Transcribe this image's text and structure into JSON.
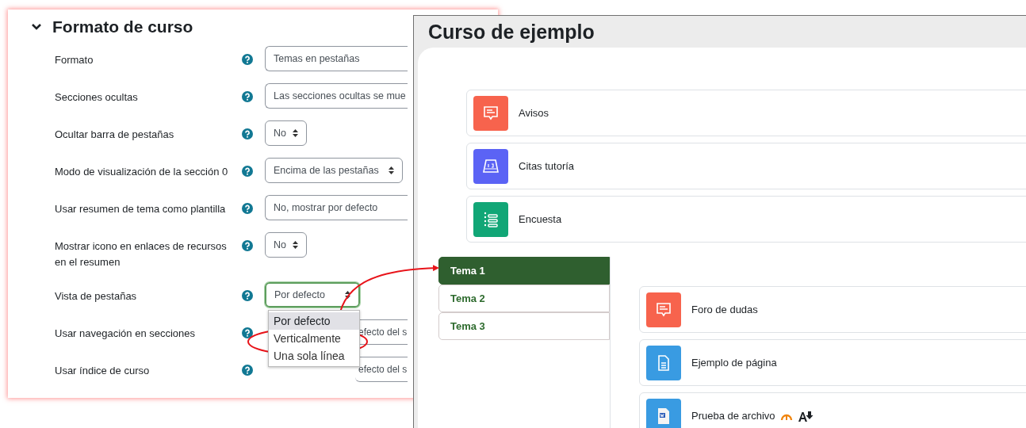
{
  "settings": {
    "title": "Formato de curso",
    "expanded": true,
    "rows": [
      {
        "label": "Formato",
        "kind": "select",
        "value": "Temas en pestañas",
        "open": false
      },
      {
        "label": "Secciones ocultas",
        "kind": "select",
        "value": "Las secciones ocultas se mue",
        "open": false
      },
      {
        "label": "Ocultar barra de pestañas",
        "kind": "select",
        "value": "No",
        "open": false
      },
      {
        "label": "Modo de visualización de la sección 0",
        "kind": "select",
        "value": "Encima de las pestañas",
        "open": false
      },
      {
        "label": "Usar resumen de tema como plantilla",
        "kind": "select",
        "value": "No, mostrar por defecto",
        "open": false
      },
      {
        "label": "Mostrar icono en enlaces de recursos en el resumen",
        "kind": "select",
        "value": "No",
        "open": false
      },
      {
        "label": "Vista de pestañas",
        "kind": "select",
        "value": "Por defecto",
        "open": true,
        "options": [
          {
            "label": "Por defecto",
            "selected": true
          },
          {
            "label": "Verticalmente",
            "selected": false
          },
          {
            "label": "Una sola línea",
            "selected": false
          }
        ]
      },
      {
        "label": "Usar navegación en secciones",
        "kind": "covered",
        "value": "efecto del s",
        "open": false
      },
      {
        "label": "Usar índice de curso",
        "kind": "covered",
        "value": "efecto del s",
        "open": false
      }
    ]
  },
  "course": {
    "title": "Curso de ejemplo",
    "top_activities": [
      {
        "name": "Avisos",
        "kind": "forum",
        "indicators": false
      },
      {
        "name": "Citas tutoría",
        "kind": "scheduler",
        "indicators": false
      },
      {
        "name": "Encuesta",
        "kind": "survey",
        "indicators": false
      }
    ],
    "tabs": [
      {
        "label": "Tema 1",
        "selected": true
      },
      {
        "label": "Tema 2",
        "selected": false
      },
      {
        "label": "Tema 3",
        "selected": false
      }
    ],
    "activities": [
      {
        "name": "Foro de dudas",
        "kind": "forum",
        "indicators": false
      },
      {
        "name": "Ejemplo de página",
        "kind": "page",
        "indicators": false
      },
      {
        "name": "Prueba de archivo",
        "kind": "file",
        "indicators": true
      }
    ]
  }
}
